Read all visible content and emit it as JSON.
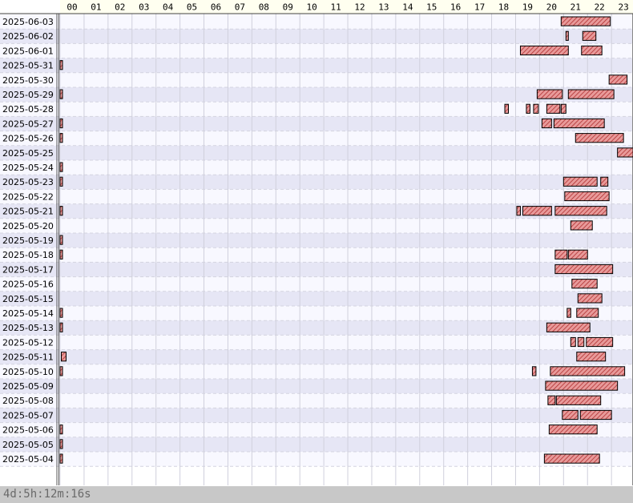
{
  "chart_data": {
    "type": "gantt",
    "x_unit": "hour of day",
    "xlim": [
      0,
      24
    ],
    "hour_labels": [
      "00",
      "01",
      "02",
      "03",
      "04",
      "05",
      "06",
      "07",
      "08",
      "09",
      "10",
      "11",
      "12",
      "13",
      "14",
      "15",
      "16",
      "17",
      "18",
      "19",
      "20",
      "21",
      "22",
      "23"
    ],
    "rows": [
      {
        "date": "2025-06-03",
        "bars": [
          [
            20.9,
            22.95
          ]
        ]
      },
      {
        "date": "2025-06-02",
        "bars": [
          [
            21.1,
            21.2
          ],
          [
            21.8,
            22.35
          ]
        ]
      },
      {
        "date": "2025-06-01",
        "bars": [
          [
            19.2,
            21.2
          ],
          [
            21.75,
            22.6
          ]
        ]
      },
      {
        "date": "2025-05-31",
        "bars": [
          [
            0.0,
            0.1
          ]
        ]
      },
      {
        "date": "2025-05-30",
        "bars": [
          [
            22.9,
            23.65
          ]
        ]
      },
      {
        "date": "2025-05-29",
        "bars": [
          [
            0.0,
            0.1
          ],
          [
            19.9,
            20.95
          ],
          [
            21.2,
            23.1
          ]
        ]
      },
      {
        "date": "2025-05-28",
        "bars": [
          [
            18.55,
            18.7
          ],
          [
            19.45,
            19.6
          ],
          [
            19.75,
            19.95
          ],
          [
            20.3,
            20.85
          ],
          [
            20.9,
            21.1
          ]
        ]
      },
      {
        "date": "2025-05-27",
        "bars": [
          [
            0.0,
            0.1
          ],
          [
            20.1,
            20.5
          ],
          [
            20.6,
            22.7
          ]
        ]
      },
      {
        "date": "2025-05-26",
        "bars": [
          [
            0.0,
            0.1
          ],
          [
            21.5,
            23.5
          ]
        ]
      },
      {
        "date": "2025-05-25",
        "bars": [
          [
            23.25,
            23.9
          ]
        ]
      },
      {
        "date": "2025-05-24",
        "bars": [
          [
            0.0,
            0.1
          ]
        ]
      },
      {
        "date": "2025-05-23",
        "bars": [
          [
            0.0,
            0.1
          ],
          [
            21.0,
            22.4
          ],
          [
            22.55,
            22.85
          ]
        ]
      },
      {
        "date": "2025-05-22",
        "bars": [
          [
            21.05,
            22.9
          ]
        ]
      },
      {
        "date": "2025-05-21",
        "bars": [
          [
            0.0,
            0.1
          ],
          [
            19.05,
            19.2
          ],
          [
            19.3,
            20.5
          ],
          [
            20.65,
            22.8
          ]
        ]
      },
      {
        "date": "2025-05-20",
        "bars": [
          [
            21.3,
            22.2
          ]
        ]
      },
      {
        "date": "2025-05-19",
        "bars": [
          [
            0.0,
            0.1
          ]
        ]
      },
      {
        "date": "2025-05-18",
        "bars": [
          [
            0.0,
            0.1
          ],
          [
            20.65,
            21.15
          ],
          [
            21.2,
            22.0
          ]
        ]
      },
      {
        "date": "2025-05-17",
        "bars": [
          [
            20.65,
            23.05
          ]
        ]
      },
      {
        "date": "2025-05-16",
        "bars": [
          [
            21.35,
            22.4
          ]
        ]
      },
      {
        "date": "2025-05-15",
        "bars": [
          [
            21.6,
            22.6
          ]
        ]
      },
      {
        "date": "2025-05-14",
        "bars": [
          [
            0.0,
            0.1
          ],
          [
            21.15,
            21.3
          ],
          [
            21.55,
            22.45
          ]
        ]
      },
      {
        "date": "2025-05-13",
        "bars": [
          [
            0.0,
            0.1
          ],
          [
            20.3,
            22.1
          ]
        ]
      },
      {
        "date": "2025-05-12",
        "bars": [
          [
            21.3,
            21.5
          ],
          [
            21.6,
            21.85
          ],
          [
            21.95,
            23.05
          ]
        ]
      },
      {
        "date": "2025-05-11",
        "bars": [
          [
            0.05,
            0.25
          ],
          [
            21.55,
            22.75
          ]
        ]
      },
      {
        "date": "2025-05-10",
        "bars": [
          [
            0.0,
            0.1
          ],
          [
            19.7,
            19.85
          ],
          [
            20.45,
            23.55
          ]
        ]
      },
      {
        "date": "2025-05-09",
        "bars": [
          [
            20.25,
            23.25
          ]
        ]
      },
      {
        "date": "2025-05-08",
        "bars": [
          [
            20.35,
            20.65
          ],
          [
            20.7,
            22.55
          ]
        ]
      },
      {
        "date": "2025-05-07",
        "bars": [
          [
            20.95,
            21.6
          ],
          [
            21.7,
            23.0
          ]
        ]
      },
      {
        "date": "2025-05-06",
        "bars": [
          [
            0.0,
            0.1
          ],
          [
            20.4,
            22.4
          ]
        ]
      },
      {
        "date": "2025-05-05",
        "bars": [
          [
            0.0,
            0.1
          ]
        ]
      },
      {
        "date": "2025-05-04",
        "bars": [
          [
            0.0,
            0.1
          ],
          [
            20.2,
            22.5
          ]
        ]
      }
    ],
    "total_label": "4d:5h:12m:16s",
    "colors": {
      "bar_fill": "#e89a9a",
      "bar_stripe": "#b03030",
      "bar_border": "#000000",
      "header_bg": "#fffff0",
      "row_alt": "#e6e6f5",
      "row_base": "#f8f8ff",
      "footer_bg": "#c8c8c8"
    }
  }
}
